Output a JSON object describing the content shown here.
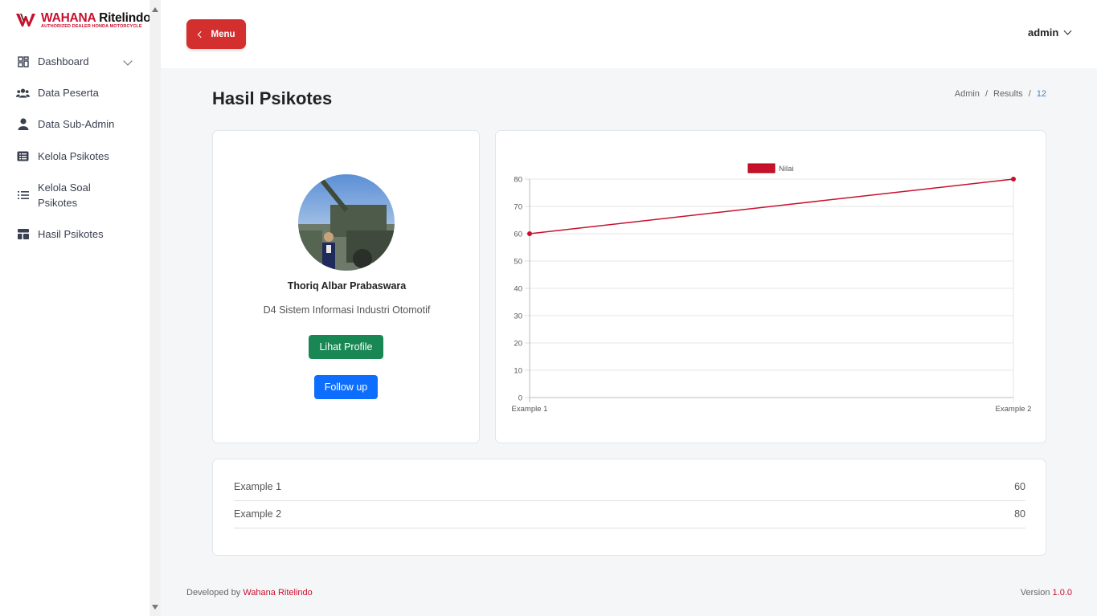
{
  "logo": {
    "brand_red": "WAHANA",
    "brand_dark": "Ritelindo",
    "tagline": "AUTHORIZED DEALER HONDA MOTORCYCLE"
  },
  "sidebar": {
    "items": [
      {
        "label": "Dashboard",
        "icon": "dashboard-grid-icon"
      },
      {
        "label": "Data Peserta",
        "icon": "users-icon"
      },
      {
        "label": "Data Sub-Admin",
        "icon": "user-icon"
      },
      {
        "label": "Kelola Psikotes",
        "icon": "list-box-icon"
      },
      {
        "label": "Kelola Soal Psikotes",
        "icon": "list-icon"
      },
      {
        "label": "Hasil Psikotes",
        "icon": "layout-icon"
      }
    ]
  },
  "header": {
    "menu_label": "Menu",
    "user_label": "admin"
  },
  "page": {
    "title": "Hasil Psikotes",
    "breadcrumb": [
      "Admin",
      "/",
      "Results",
      "/",
      "12"
    ]
  },
  "profile": {
    "name": "Thoriq Albar Prabaswara",
    "program": "D4 Sistem Informasi Industri Otomotif",
    "view_profile_label": "Lihat Profile",
    "follow_up_label": "Follow up"
  },
  "chart_data": {
    "type": "line",
    "x": [
      "Example 1",
      "Example 2"
    ],
    "series": [
      {
        "name": "Nilai",
        "values": [
          60,
          80
        ],
        "color": "#c8102e"
      }
    ],
    "ylim": [
      0,
      80
    ],
    "yticks": [
      0,
      10,
      20,
      30,
      40,
      50,
      60,
      70,
      80
    ],
    "grid": true,
    "legend": "top-center"
  },
  "results_table": [
    {
      "label": "Example 1",
      "value": "60"
    },
    {
      "label": "Example 2",
      "value": "80"
    }
  ],
  "footer": {
    "developed_by": "Developed by",
    "brand": "Wahana Ritelindo",
    "version_label": "Version",
    "version": "1.0.0"
  },
  "colors": {
    "accent_red": "#d32f2f",
    "green": "#198754",
    "blue": "#0d6efd"
  }
}
